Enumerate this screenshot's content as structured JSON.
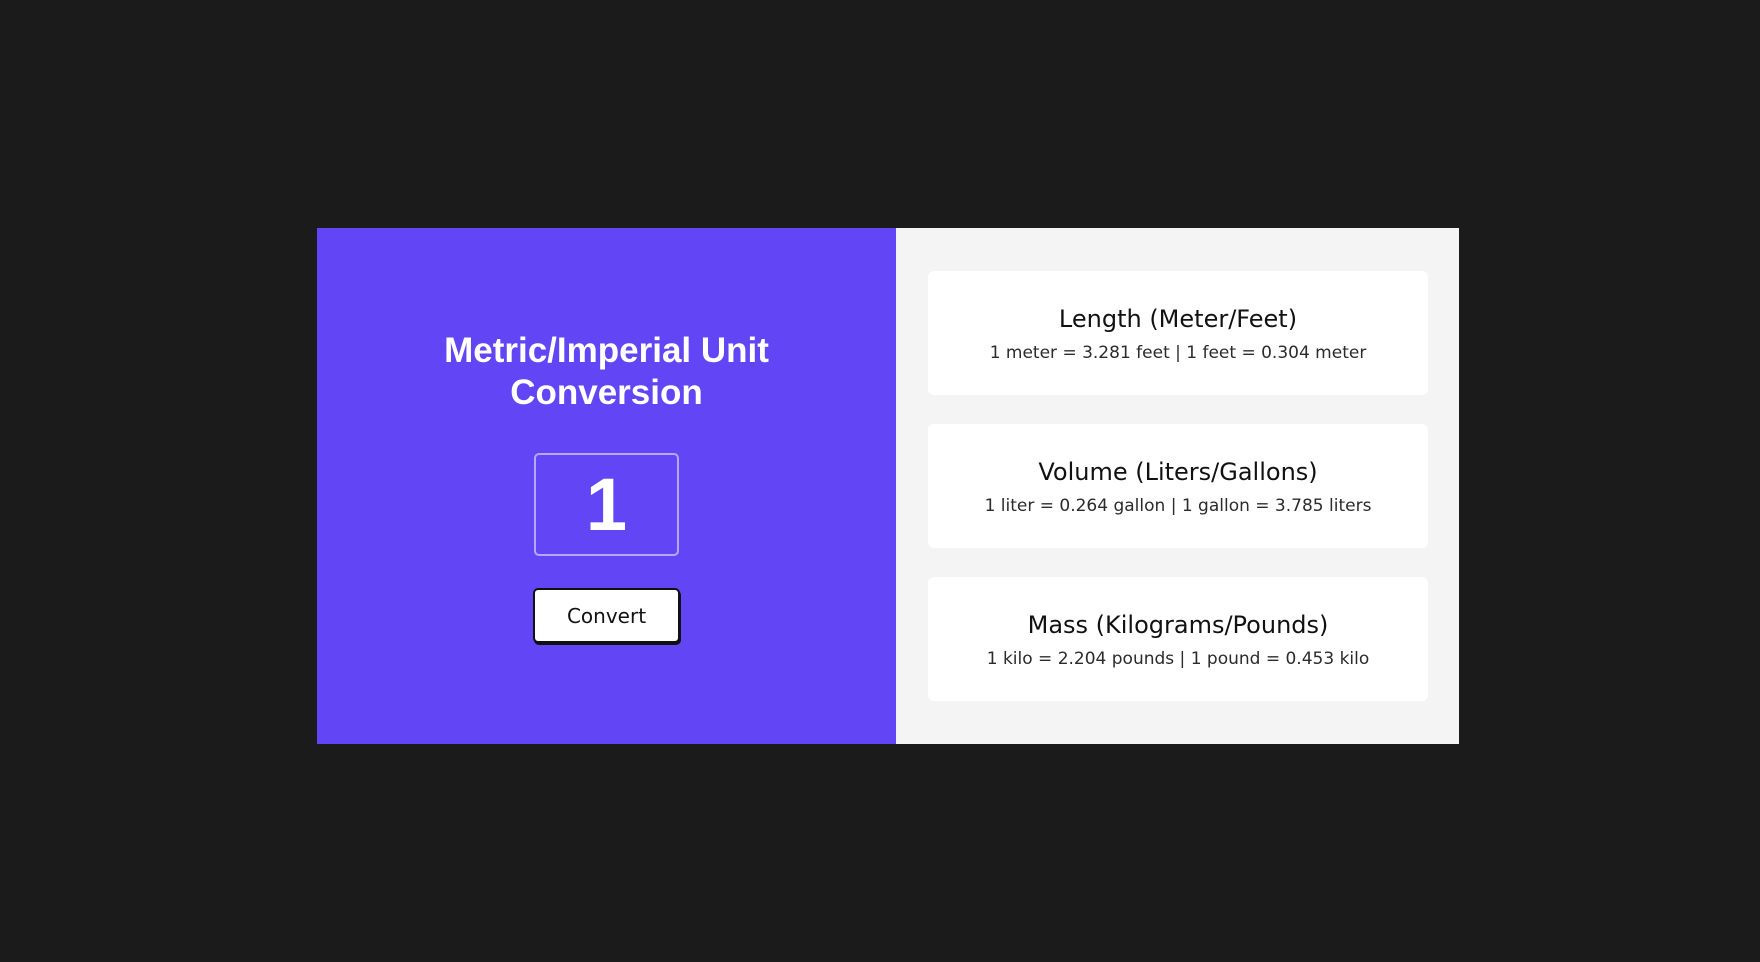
{
  "app": {
    "title": "Metric/Imperial Unit Conversion",
    "input": {
      "value": "1",
      "placeholder": ""
    },
    "convert_label": "Convert"
  },
  "conversions": [
    {
      "title": "Length (Meter/Feet)",
      "text": "1 meter = 3.281 feet | 1 feet = 0.304 meter"
    },
    {
      "title": "Volume (Liters/Gallons)",
      "text": "1 liter = 0.264 gallon | 1 gallon = 3.785 liters"
    },
    {
      "title": "Mass (Kilograms/Pounds)",
      "text": "1 kilo = 2.204 pounds | 1 pound = 0.453 kilo"
    }
  ],
  "colors": {
    "background": "#1b1b1b",
    "accent": "#6246f6",
    "panel": "#f4f4f4",
    "card": "#ffffff"
  }
}
